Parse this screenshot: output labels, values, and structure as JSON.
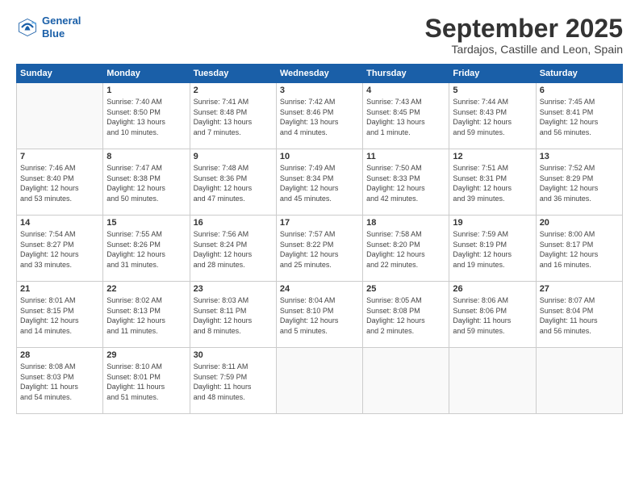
{
  "logo": {
    "line1": "General",
    "line2": "Blue"
  },
  "title": "September 2025",
  "location": "Tardajos, Castille and Leon, Spain",
  "weekdays": [
    "Sunday",
    "Monday",
    "Tuesday",
    "Wednesday",
    "Thursday",
    "Friday",
    "Saturday"
  ],
  "weeks": [
    [
      {
        "day": "",
        "info": ""
      },
      {
        "day": "1",
        "info": "Sunrise: 7:40 AM\nSunset: 8:50 PM\nDaylight: 13 hours\nand 10 minutes."
      },
      {
        "day": "2",
        "info": "Sunrise: 7:41 AM\nSunset: 8:48 PM\nDaylight: 13 hours\nand 7 minutes."
      },
      {
        "day": "3",
        "info": "Sunrise: 7:42 AM\nSunset: 8:46 PM\nDaylight: 13 hours\nand 4 minutes."
      },
      {
        "day": "4",
        "info": "Sunrise: 7:43 AM\nSunset: 8:45 PM\nDaylight: 13 hours\nand 1 minute."
      },
      {
        "day": "5",
        "info": "Sunrise: 7:44 AM\nSunset: 8:43 PM\nDaylight: 12 hours\nand 59 minutes."
      },
      {
        "day": "6",
        "info": "Sunrise: 7:45 AM\nSunset: 8:41 PM\nDaylight: 12 hours\nand 56 minutes."
      }
    ],
    [
      {
        "day": "7",
        "info": "Sunrise: 7:46 AM\nSunset: 8:40 PM\nDaylight: 12 hours\nand 53 minutes."
      },
      {
        "day": "8",
        "info": "Sunrise: 7:47 AM\nSunset: 8:38 PM\nDaylight: 12 hours\nand 50 minutes."
      },
      {
        "day": "9",
        "info": "Sunrise: 7:48 AM\nSunset: 8:36 PM\nDaylight: 12 hours\nand 47 minutes."
      },
      {
        "day": "10",
        "info": "Sunrise: 7:49 AM\nSunset: 8:34 PM\nDaylight: 12 hours\nand 45 minutes."
      },
      {
        "day": "11",
        "info": "Sunrise: 7:50 AM\nSunset: 8:33 PM\nDaylight: 12 hours\nand 42 minutes."
      },
      {
        "day": "12",
        "info": "Sunrise: 7:51 AM\nSunset: 8:31 PM\nDaylight: 12 hours\nand 39 minutes."
      },
      {
        "day": "13",
        "info": "Sunrise: 7:52 AM\nSunset: 8:29 PM\nDaylight: 12 hours\nand 36 minutes."
      }
    ],
    [
      {
        "day": "14",
        "info": "Sunrise: 7:54 AM\nSunset: 8:27 PM\nDaylight: 12 hours\nand 33 minutes."
      },
      {
        "day": "15",
        "info": "Sunrise: 7:55 AM\nSunset: 8:26 PM\nDaylight: 12 hours\nand 31 minutes."
      },
      {
        "day": "16",
        "info": "Sunrise: 7:56 AM\nSunset: 8:24 PM\nDaylight: 12 hours\nand 28 minutes."
      },
      {
        "day": "17",
        "info": "Sunrise: 7:57 AM\nSunset: 8:22 PM\nDaylight: 12 hours\nand 25 minutes."
      },
      {
        "day": "18",
        "info": "Sunrise: 7:58 AM\nSunset: 8:20 PM\nDaylight: 12 hours\nand 22 minutes."
      },
      {
        "day": "19",
        "info": "Sunrise: 7:59 AM\nSunset: 8:19 PM\nDaylight: 12 hours\nand 19 minutes."
      },
      {
        "day": "20",
        "info": "Sunrise: 8:00 AM\nSunset: 8:17 PM\nDaylight: 12 hours\nand 16 minutes."
      }
    ],
    [
      {
        "day": "21",
        "info": "Sunrise: 8:01 AM\nSunset: 8:15 PM\nDaylight: 12 hours\nand 14 minutes."
      },
      {
        "day": "22",
        "info": "Sunrise: 8:02 AM\nSunset: 8:13 PM\nDaylight: 12 hours\nand 11 minutes."
      },
      {
        "day": "23",
        "info": "Sunrise: 8:03 AM\nSunset: 8:11 PM\nDaylight: 12 hours\nand 8 minutes."
      },
      {
        "day": "24",
        "info": "Sunrise: 8:04 AM\nSunset: 8:10 PM\nDaylight: 12 hours\nand 5 minutes."
      },
      {
        "day": "25",
        "info": "Sunrise: 8:05 AM\nSunset: 8:08 PM\nDaylight: 12 hours\nand 2 minutes."
      },
      {
        "day": "26",
        "info": "Sunrise: 8:06 AM\nSunset: 8:06 PM\nDaylight: 11 hours\nand 59 minutes."
      },
      {
        "day": "27",
        "info": "Sunrise: 8:07 AM\nSunset: 8:04 PM\nDaylight: 11 hours\nand 56 minutes."
      }
    ],
    [
      {
        "day": "28",
        "info": "Sunrise: 8:08 AM\nSunset: 8:03 PM\nDaylight: 11 hours\nand 54 minutes."
      },
      {
        "day": "29",
        "info": "Sunrise: 8:10 AM\nSunset: 8:01 PM\nDaylight: 11 hours\nand 51 minutes."
      },
      {
        "day": "30",
        "info": "Sunrise: 8:11 AM\nSunset: 7:59 PM\nDaylight: 11 hours\nand 48 minutes."
      },
      {
        "day": "",
        "info": ""
      },
      {
        "day": "",
        "info": ""
      },
      {
        "day": "",
        "info": ""
      },
      {
        "day": "",
        "info": ""
      }
    ]
  ]
}
